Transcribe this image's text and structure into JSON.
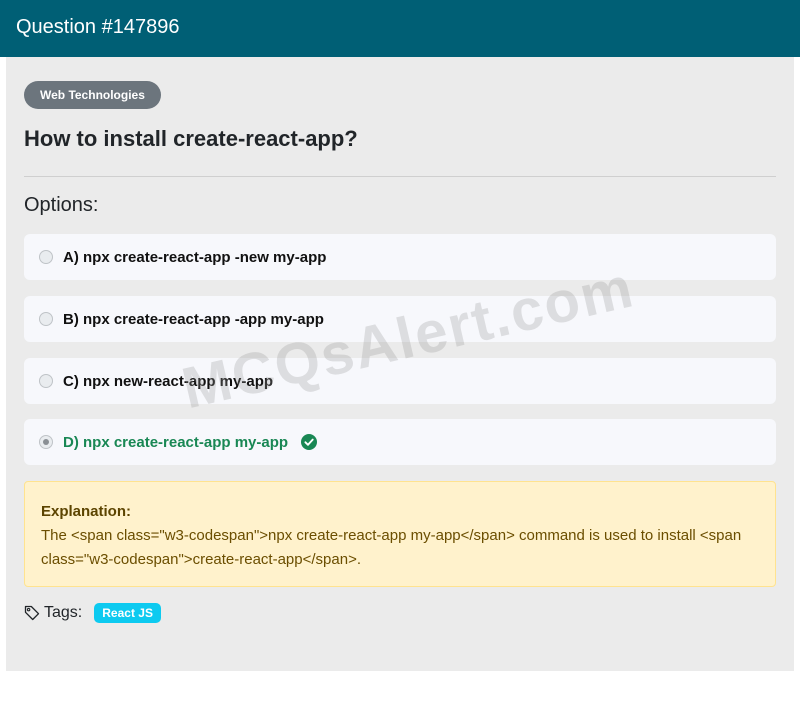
{
  "header": {
    "title": "Question #147896",
    "background_color": "#005f75"
  },
  "question": {
    "category": "Web Technologies",
    "title": "How to install create-react-app?",
    "options_label": "Options:",
    "options": [
      {
        "label": "A) npx create-react-app -new my-app",
        "selected": false,
        "correct": false
      },
      {
        "label": "B) npx create-react-app -app my-app",
        "selected": false,
        "correct": false
      },
      {
        "label": "C) npx new-react-app my-app",
        "selected": false,
        "correct": false
      },
      {
        "label": "D) npx create-react-app my-app",
        "selected": true,
        "correct": true
      }
    ],
    "correct_icon": "check-circle-icon",
    "correct_color": "#198754"
  },
  "watermark": {
    "text": "MCQsAlert.com"
  },
  "explanation": {
    "title": "Explanation:",
    "text": "The <span class=\"w3-codespan\">npx create-react-app my-app</span> command is used to install <span class=\"w3-codespan\">create-react-app</span>."
  },
  "tags": {
    "icon": "tag-icon",
    "label": "Tags:",
    "items": [
      "React JS"
    ],
    "badge_color": "#0dcaf0"
  }
}
